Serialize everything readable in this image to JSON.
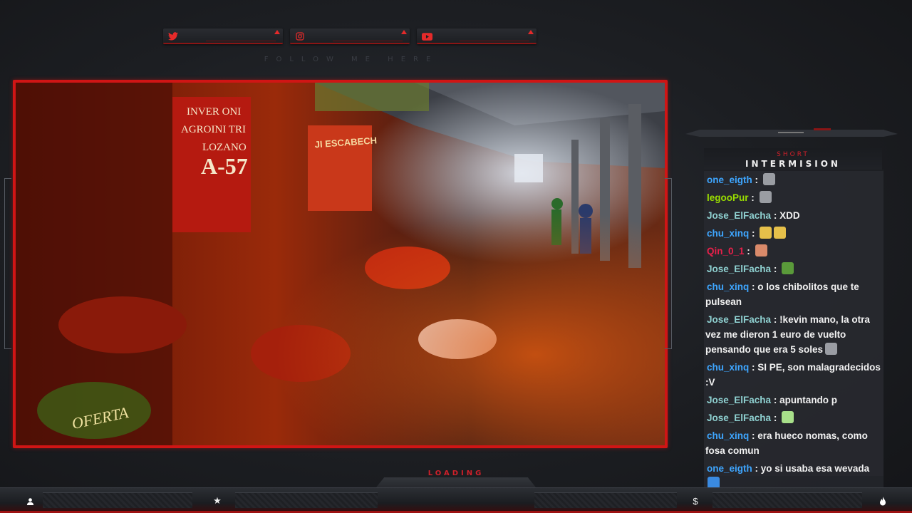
{
  "social": [
    {
      "icon": "twitter-icon",
      "label": ""
    },
    {
      "icon": "instagram-icon",
      "label": ""
    },
    {
      "icon": "youtube-icon",
      "label": ""
    }
  ],
  "follow_text": "FOLLOW ME HERE",
  "colors": {
    "accent": "#d01515",
    "panel": "#1e2024"
  },
  "chat": {
    "title_small": "SHORT",
    "title_big": "INTERMISION",
    "messages": [
      {
        "user": "one_eigth",
        "color": "#3ea6ff",
        "text": "",
        "emotes": [
          "gray"
        ]
      },
      {
        "user": "legooPur",
        "color": "#9ade00",
        "text": "",
        "emotes": [
          "gray"
        ]
      },
      {
        "user": "Jose_ElFacha",
        "color": "#8fd1d1",
        "text": "XDD",
        "emotes": []
      },
      {
        "user": "chu_xinq",
        "color": "#3ea6ff",
        "text": "",
        "emotes": [
          "pepe-hat",
          "pepe-hat"
        ]
      },
      {
        "user": "Qin_0_1",
        "color": "#e8204a",
        "text": "",
        "emotes": [
          "face"
        ]
      },
      {
        "user": "Jose_ElFacha",
        "color": "#8fd1d1",
        "text": "",
        "emotes": [
          "pepe"
        ]
      },
      {
        "user": "chu_xinq",
        "color": "#3ea6ff",
        "text": "o los chibolitos que te pulsean",
        "emotes": []
      },
      {
        "user": "Jose_ElFacha",
        "color": "#8fd1d1",
        "text": "!kevin mano, la otra vez me dieron 1 euro de vuelto pensando que era 5 soles",
        "emotes": [
          "gray"
        ]
      },
      {
        "user": "chu_xinq",
        "color": "#3ea6ff",
        "text": "SI PE, son malagradecidos :V",
        "emotes": []
      },
      {
        "user": "Jose_ElFacha",
        "color": "#8fd1d1",
        "text": "apuntando p",
        "emotes": []
      },
      {
        "user": "Jose_ElFacha",
        "color": "#8fd1d1",
        "text": "",
        "emotes": [
          "pepe-small"
        ]
      },
      {
        "user": "chu_xinq",
        "color": "#3ea6ff",
        "text": "era hueco nomas, como fosa comun",
        "emotes": []
      },
      {
        "user": "one_eigth",
        "color": "#3ea6ff",
        "text": "yo si usaba esa wevada",
        "emotes": [
          "blue"
        ]
      }
    ]
  },
  "loading_text": "LOADING",
  "bottom_icons": [
    "user-icon",
    "star-icon",
    "dollar-icon",
    "flame-icon"
  ]
}
